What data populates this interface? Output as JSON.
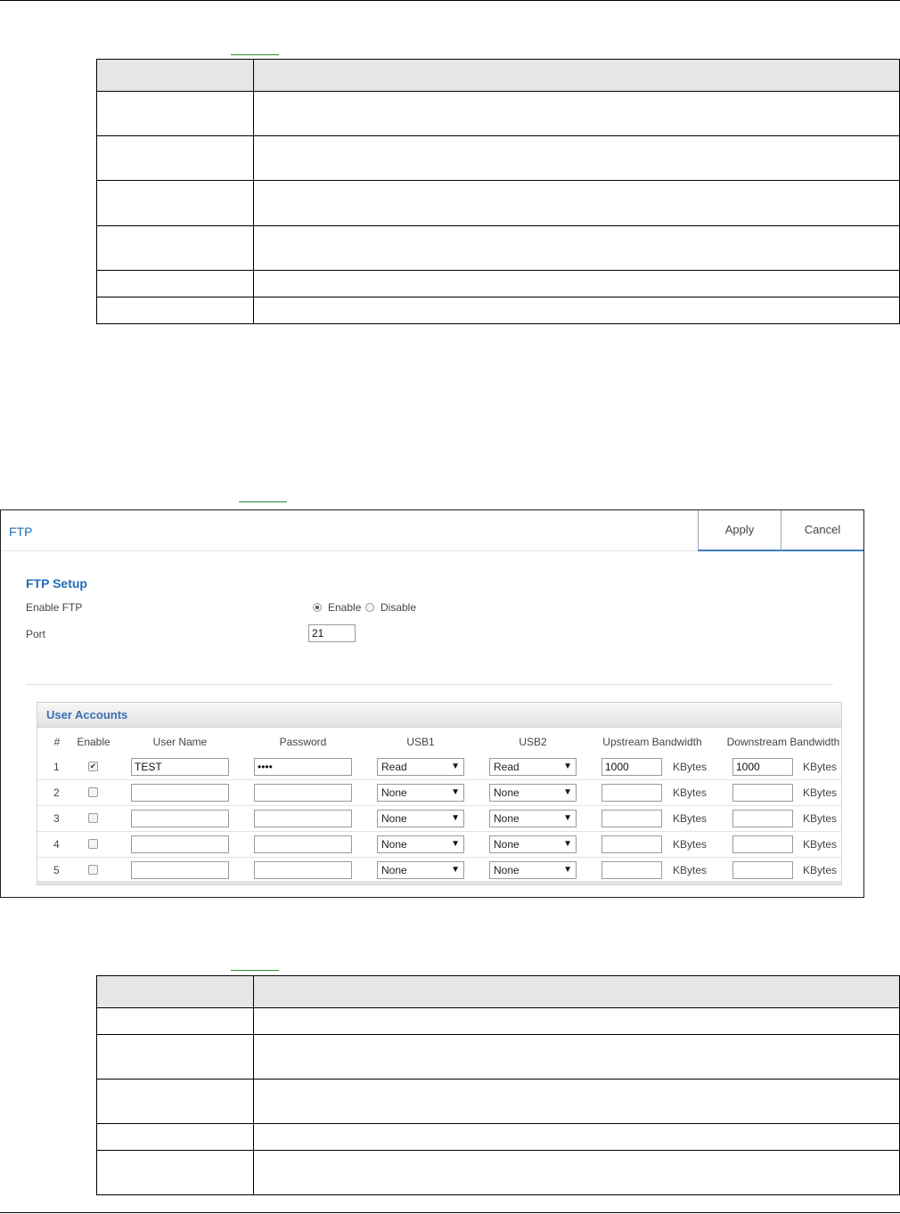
{
  "ftp_screen": {
    "title": "FTP",
    "apply_label": "Apply",
    "cancel_label": "Cancel",
    "setup_title": "FTP Setup",
    "enable_ftp_label": "Enable FTP",
    "enable_option": "Enable",
    "disable_option": "Disable",
    "enable_selected": "Enable",
    "port_label": "Port",
    "port_value": "21",
    "accounts_title": "User Accounts",
    "columns": [
      "#",
      "Enable",
      "User Name",
      "Password",
      "USB1",
      "USB2",
      "Upstream Bandwidth",
      "Downstream Bandwidth"
    ],
    "unit": "KBytes",
    "rows": [
      {
        "num": "1",
        "enabled": true,
        "user": "TEST",
        "password": "••••",
        "usb1": "Read",
        "usb2": "Read",
        "up": "1000",
        "down": "1000"
      },
      {
        "num": "2",
        "enabled": false,
        "user": "",
        "password": "",
        "usb1": "None",
        "usb2": "None",
        "up": "",
        "down": ""
      },
      {
        "num": "3",
        "enabled": false,
        "user": "",
        "password": "",
        "usb1": "None",
        "usb2": "None",
        "up": "",
        "down": ""
      },
      {
        "num": "4",
        "enabled": false,
        "user": "",
        "password": "",
        "usb1": "None",
        "usb2": "None",
        "up": "",
        "down": ""
      },
      {
        "num": "5",
        "enabled": false,
        "user": "",
        "password": "",
        "usb1": "None",
        "usb2": "None",
        "up": "",
        "down": ""
      }
    ]
  }
}
